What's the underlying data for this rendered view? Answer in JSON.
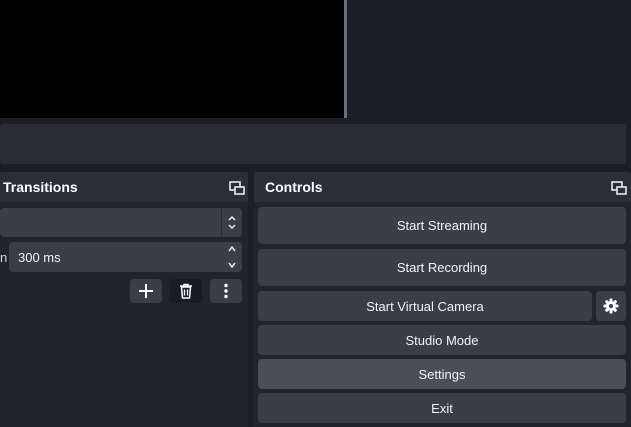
{
  "transitions": {
    "title": "Transitions",
    "duration_label_partial": "n",
    "duration_value": "300 ms",
    "buttons": {
      "add": "plus-icon",
      "remove": "trash-icon",
      "more": "kebab-icon"
    }
  },
  "controls": {
    "title": "Controls",
    "buttons": [
      "Start Streaming",
      "Start Recording",
      "Start Virtual Camera",
      "Studio Mode",
      "Settings",
      "Exit"
    ],
    "virtual_camera_settings_icon": "gear-icon"
  },
  "colors": {
    "background": "#1c1e26",
    "panel": "#22242d",
    "header": "#2b2d38",
    "button": "#3b3d49",
    "button_hover": "#4b4d59"
  }
}
